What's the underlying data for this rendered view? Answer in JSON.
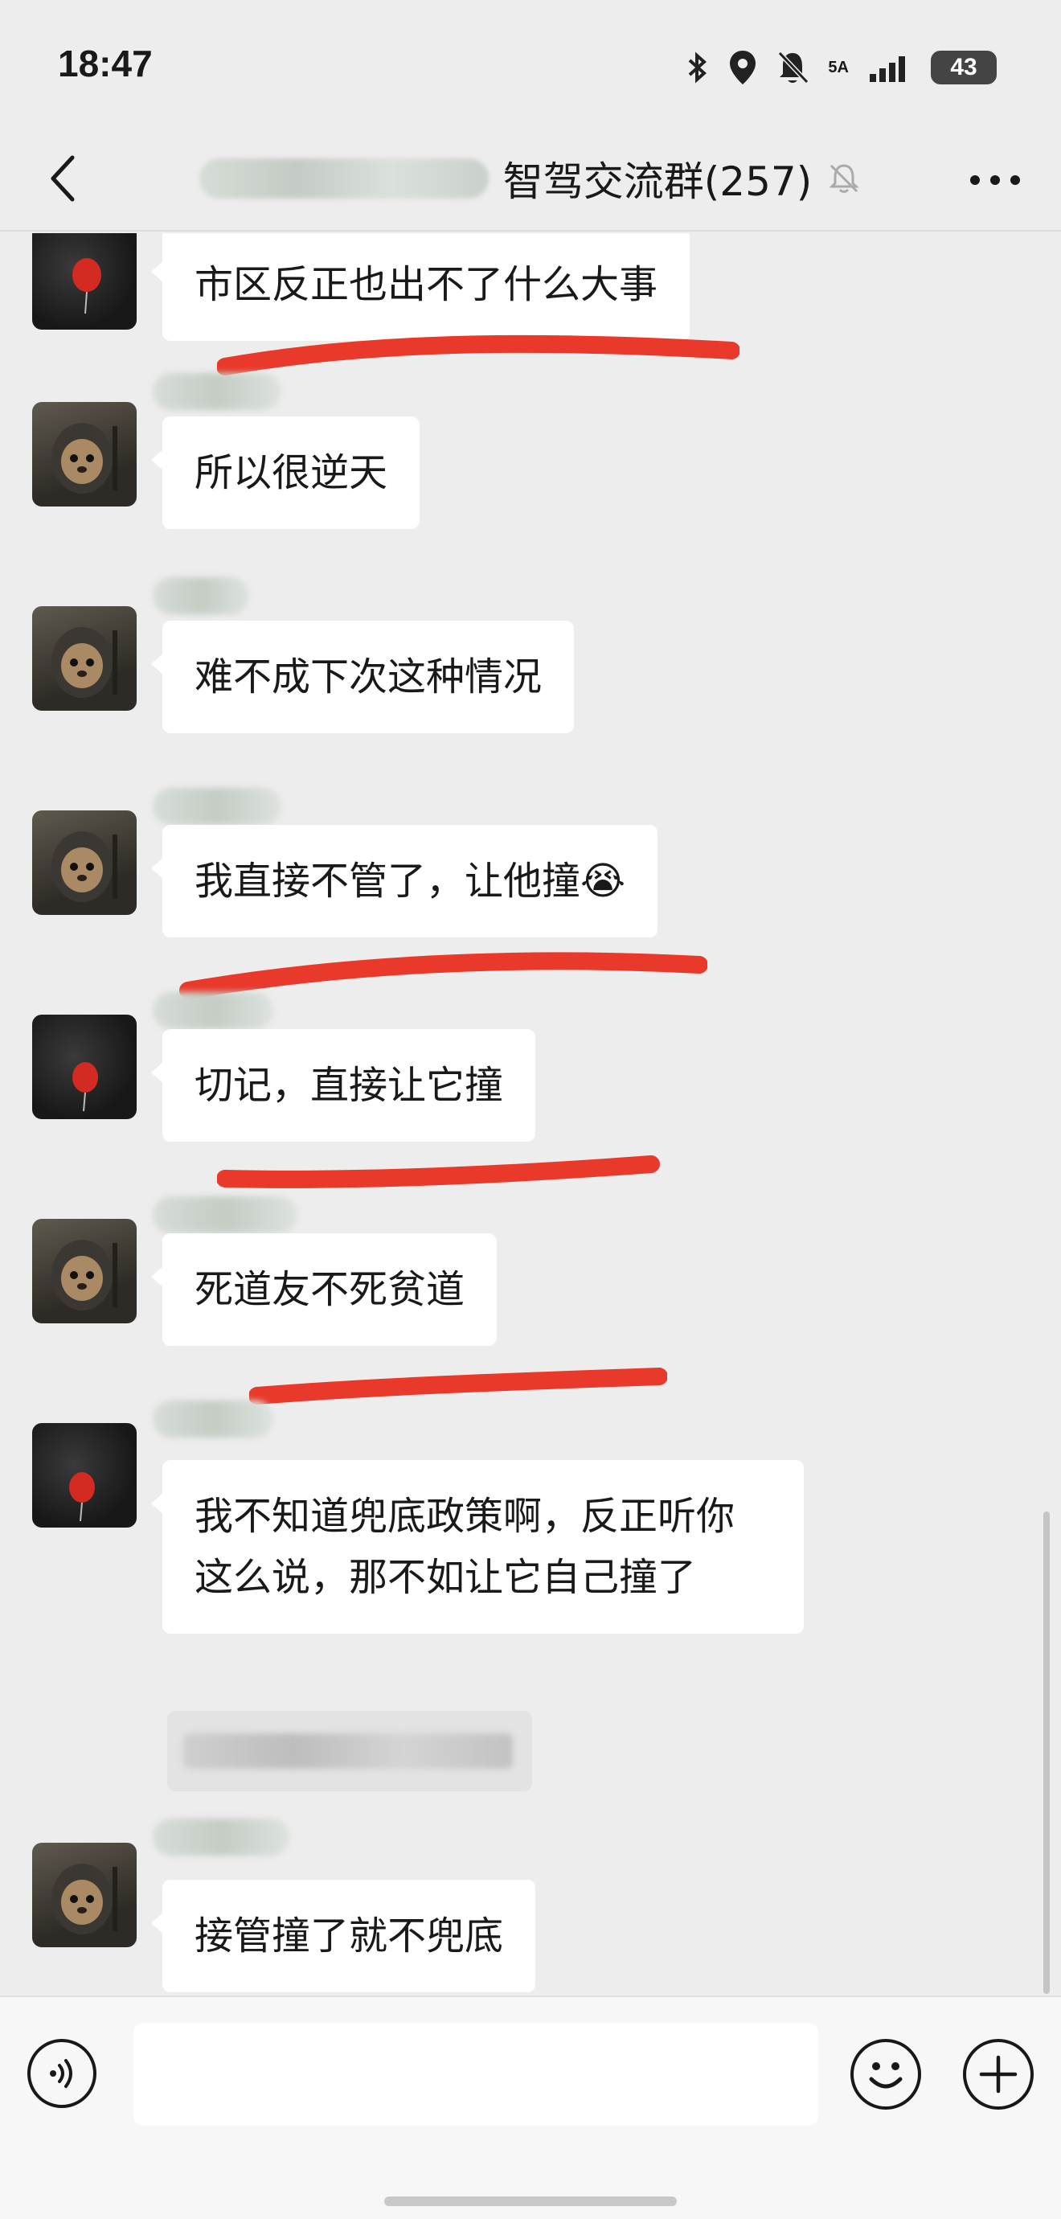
{
  "status_bar": {
    "time": "18:47",
    "battery": "43",
    "network": "5A"
  },
  "header": {
    "title": "智驾交流群(257)"
  },
  "messages": [
    {
      "text": "市区反正也出不了什么大事",
      "avatar": "red-balloon"
    },
    {
      "text": "所以很逆天",
      "avatar": "hooded-bear"
    },
    {
      "text": "难不成下次这种情况",
      "avatar": "hooded-bear"
    },
    {
      "text": "我直接不管了，让他撞😭",
      "avatar": "hooded-bear"
    },
    {
      "text": "切记，直接让它撞",
      "avatar": "red-balloon"
    },
    {
      "text": "死道友不死贫道",
      "avatar": "hooded-bear"
    },
    {
      "text": "我不知道兜底政策啊，反正听你这么说，那不如让它自己撞了",
      "avatar": "red-balloon"
    },
    {
      "text": "接管撞了就不兜底",
      "avatar": "hooded-bear"
    }
  ],
  "input": {
    "placeholder": ""
  },
  "colors": {
    "background": "#ededed",
    "bubble": "#ffffff",
    "highlight_stroke": "#e8392b"
  },
  "icons": [
    "back-icon",
    "mute-icon",
    "more-icon",
    "voice-icon",
    "emoji-icon",
    "plus-icon"
  ]
}
